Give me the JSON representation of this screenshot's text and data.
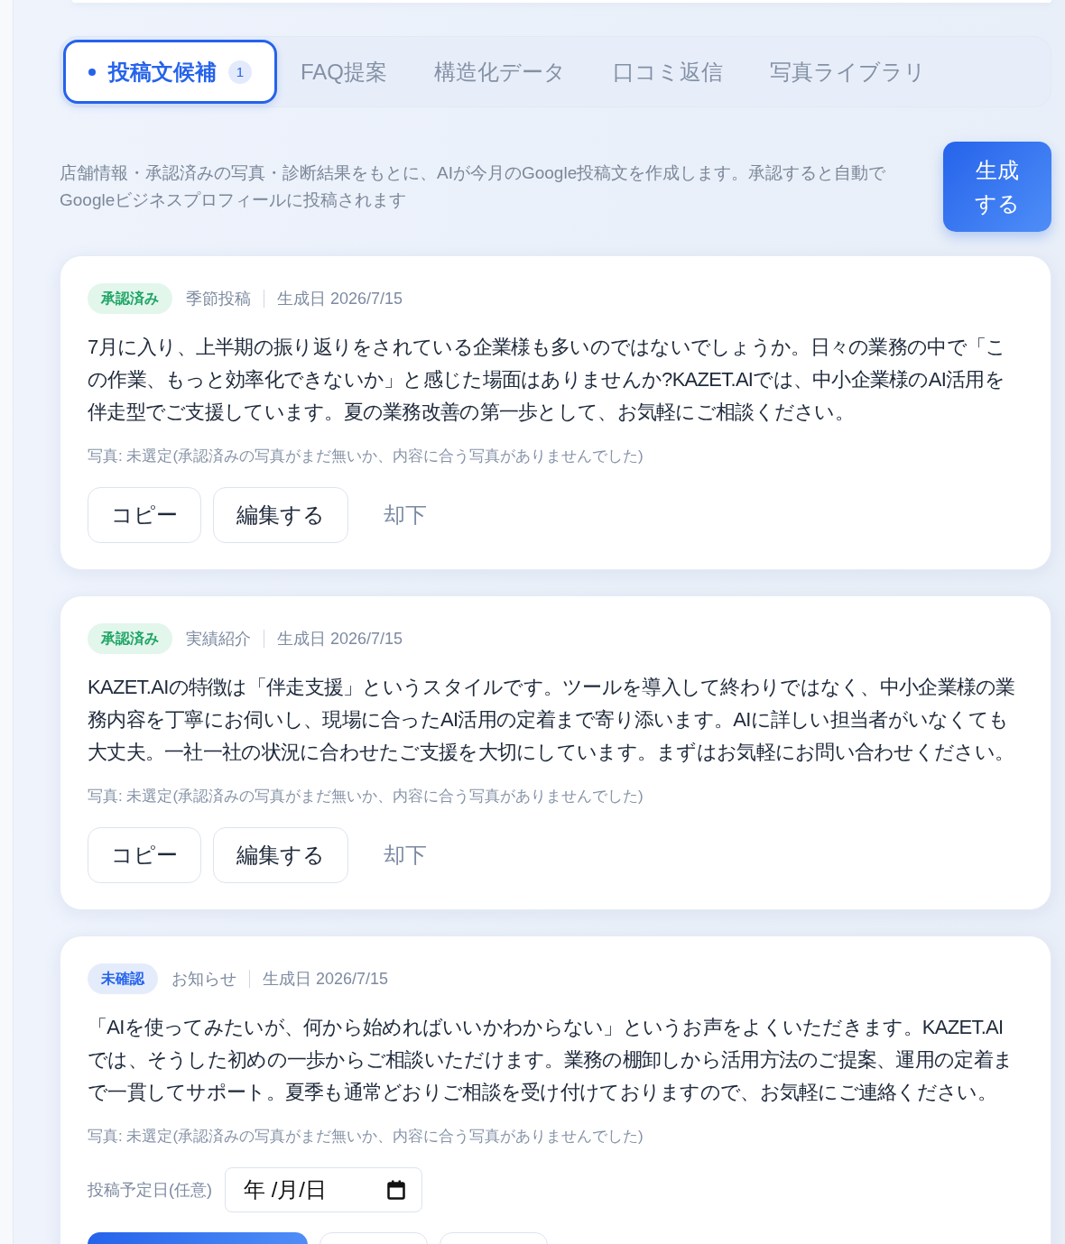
{
  "tabs": [
    {
      "label": "投稿文候補",
      "selected": true,
      "badge": "1"
    },
    {
      "label": "FAQ提案",
      "selected": false
    },
    {
      "label": "構造化データ",
      "selected": false
    },
    {
      "label": "口コミ返信",
      "selected": false
    },
    {
      "label": "写真ライブラリ",
      "selected": false
    }
  ],
  "intro": {
    "text": "店舗情報・承認済みの写真・診断結果をもとに、AIが今月のGoogle投稿文を作成します。承認すると自動でGoogleビジネスプロフィールに投稿されます",
    "generate_button": "生成する"
  },
  "posts": [
    {
      "status": {
        "label": "承認済み",
        "kind": "approved"
      },
      "category": "季節投稿",
      "generated": "生成日 2026/7/15",
      "body": "7月に入り、上半期の振り返りをされている企業様も多いのではないでしょうか。日々の業務の中で「この作業、もっと効率化できないか」と感じた場面はありませんか?KAZET.AIでは、中小企業様のAI活用を伴走型でご支援しています。夏の業務改善の第一歩として、お気軽にご相談ください。",
      "photo_note": "写真: 未選定(承認済みの写真がまだ無いか、内容に合う写真がありませんでした)",
      "actions": [
        {
          "label": "コピー",
          "kind": "outline"
        },
        {
          "label": "編集する",
          "kind": "outline"
        },
        {
          "label": "却下",
          "kind": "text"
        }
      ]
    },
    {
      "status": {
        "label": "承認済み",
        "kind": "approved"
      },
      "category": "実績紹介",
      "generated": "生成日 2026/7/15",
      "body": "KAZET.AIの特徴は「伴走支援」というスタイルです。ツールを導入して終わりではなく、中小企業様の業務内容を丁寧にお伺いし、現場に合ったAI活用の定着まで寄り添います。AIに詳しい担当者がいなくても大丈夫。一社一社の状況に合わせたご支援を大切にしています。まずはお気軽にお問い合わせください。",
      "photo_note": "写真: 未選定(承認済みの写真がまだ無いか、内容に合う写真がありませんでした)",
      "actions": [
        {
          "label": "コピー",
          "kind": "outline"
        },
        {
          "label": "編集する",
          "kind": "outline"
        },
        {
          "label": "却下",
          "kind": "text"
        }
      ]
    },
    {
      "status": {
        "label": "未確認",
        "kind": "unconfirmed"
      },
      "category": "お知らせ",
      "generated": "生成日 2026/7/15",
      "body": "「AIを使ってみたいが、何から始めればいいかわからない」というお声をよくいただきます。KAZET.AIでは、そうした初めの一歩からご相談いただけます。業務の棚卸しから活用方法のご提案、運用の定着まで一貫してサポート。夏季も通常どおりご相談を受け付けておりますので、お気軽にご連絡ください。",
      "photo_note": "写真: 未選定(承認済みの写真がまだ無いか、内容に合う写真がありませんでした)",
      "schedule": {
        "label": "投稿予定日(任意)",
        "placeholder": "年 /月/日"
      },
      "actions": [
        {
          "kind": "primary"
        },
        {
          "kind": "outline"
        },
        {
          "kind": "outline"
        }
      ]
    }
  ]
}
